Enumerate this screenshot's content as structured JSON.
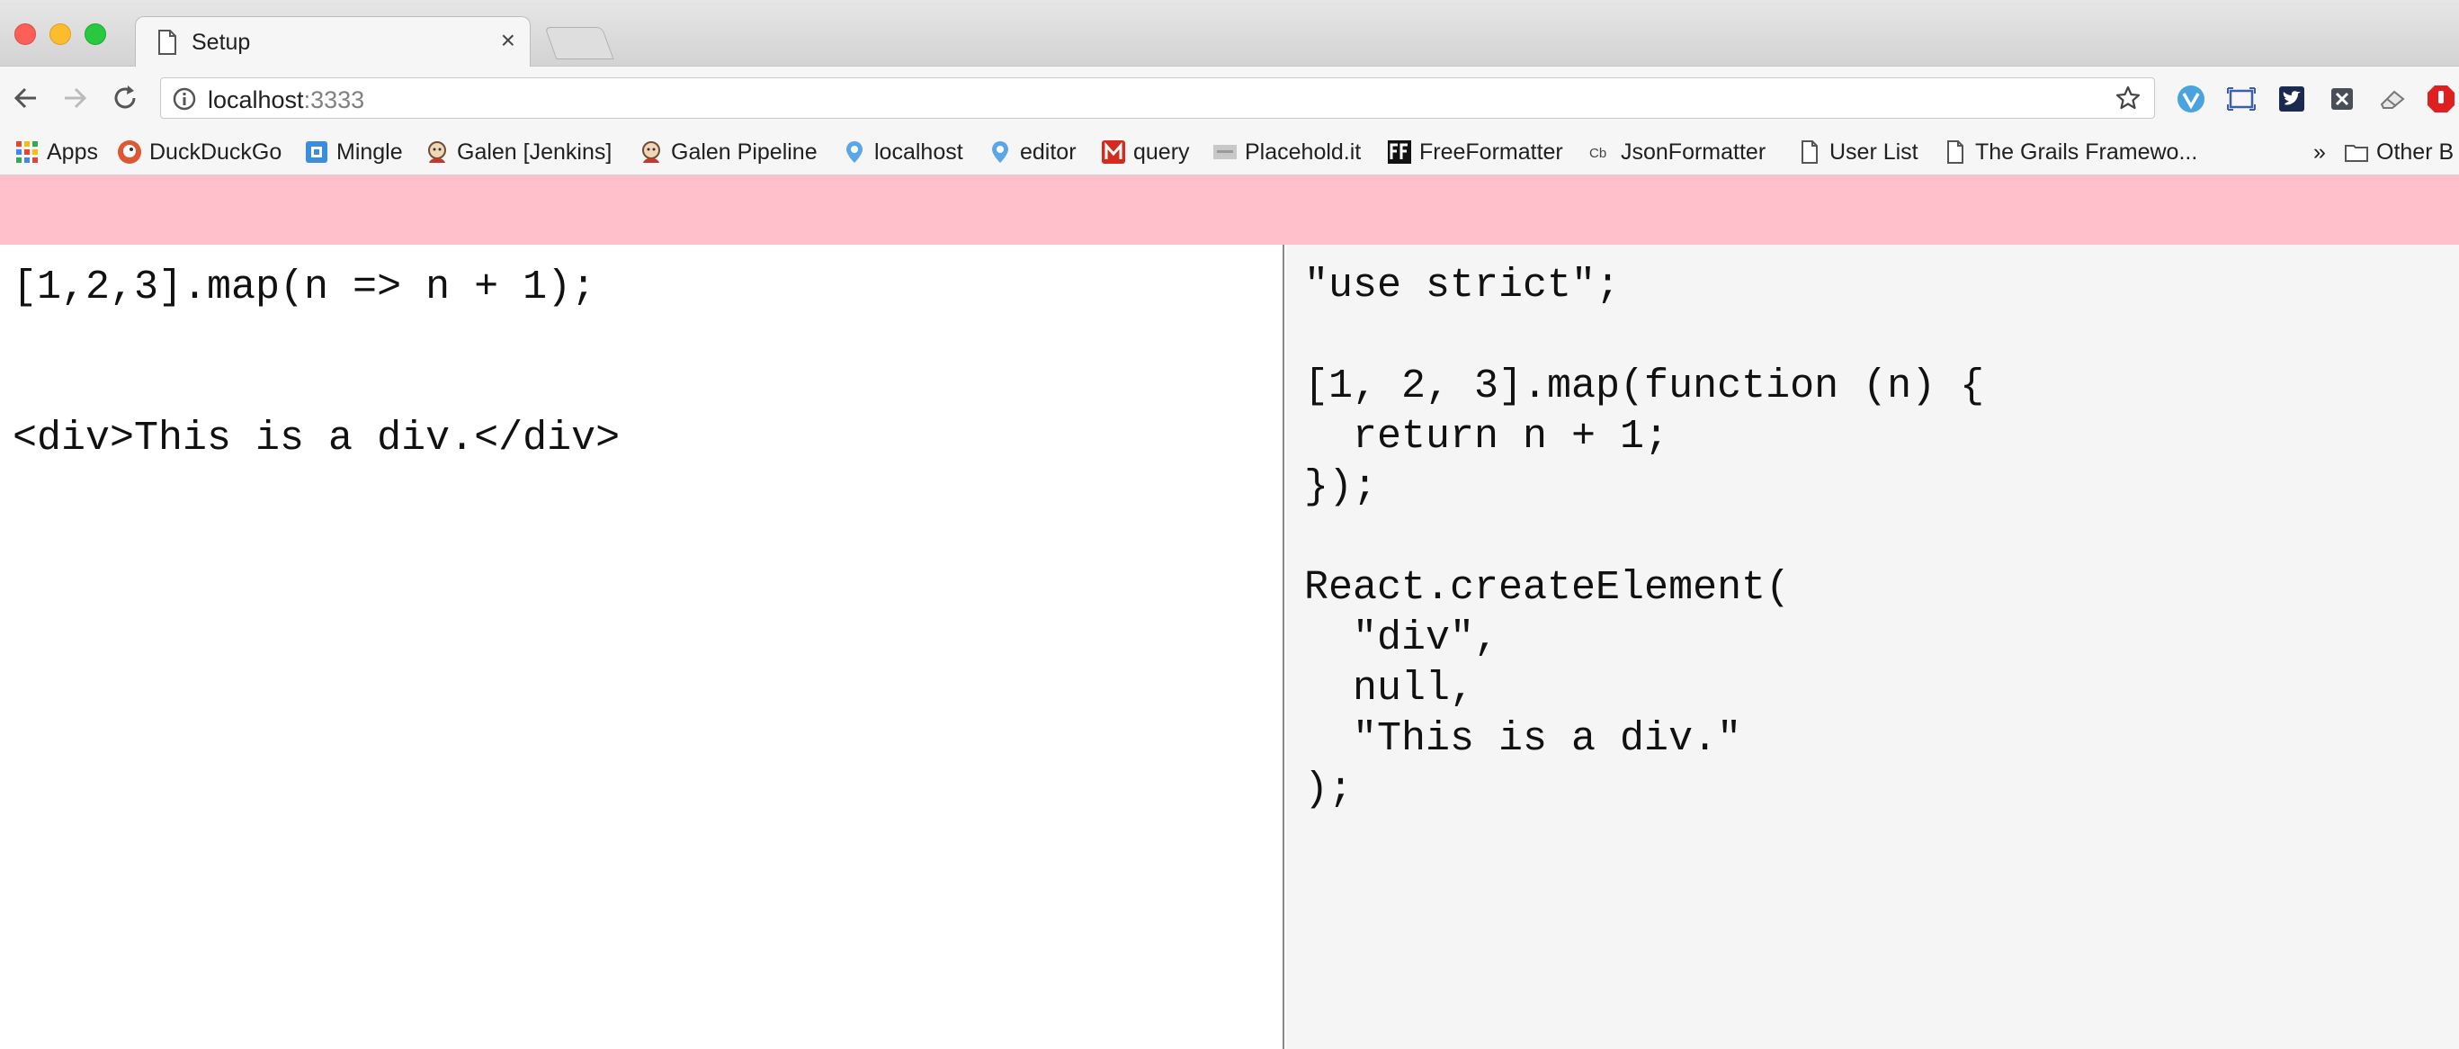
{
  "browser": {
    "tab": {
      "title": "Setup",
      "close_glyph": "×"
    },
    "address": {
      "host": "localhost",
      "port": ":3333"
    },
    "bookmarks": [
      {
        "label": "Apps",
        "icon": "apps-grid-icon"
      },
      {
        "label": "DuckDuckGo",
        "icon": "duckduckgo-icon"
      },
      {
        "label": "Mingle",
        "icon": "mingle-icon"
      },
      {
        "label": "Galen [Jenkins]",
        "icon": "jenkins-icon"
      },
      {
        "label": "Galen Pipeline",
        "icon": "jenkins-icon"
      },
      {
        "label": "localhost",
        "icon": "pin-icon"
      },
      {
        "label": "editor",
        "icon": "pin-icon"
      },
      {
        "label": "query",
        "icon": "m-icon"
      },
      {
        "label": "Placehold.it",
        "icon": "placeholder-icon"
      },
      {
        "label": "FreeFormatter",
        "icon": "ff-icon"
      },
      {
        "label": "JsonFormatter",
        "icon": "cb-icon"
      },
      {
        "label": "User List",
        "icon": "document-icon"
      },
      {
        "label": "The Grails Framewo...",
        "icon": "document-icon"
      }
    ],
    "overflow_glyph": "»",
    "other_bookmarks": "Other B"
  },
  "editor": {
    "source": "[1,2,3].map(n => n + 1);\n\n\n<div>This is a div.</div>"
  },
  "output": {
    "compiled": "\"use strict\";\n\n[1, 2, 3].map(function (n) {\n  return n + 1;\n});\n\nReact.createElement(\n  \"div\",\n  null,\n  \"This is a div.\"\n);"
  },
  "colors": {
    "banner": "#ffc0cb",
    "output_background": "#f5f5f5"
  }
}
